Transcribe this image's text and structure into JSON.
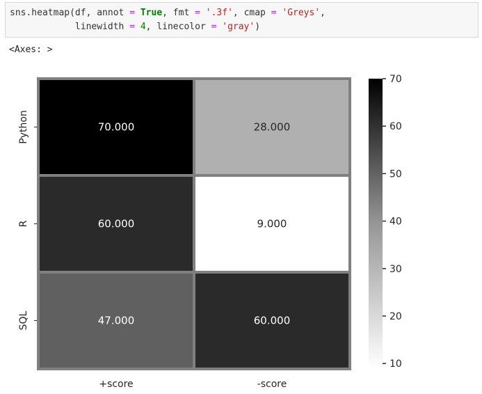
{
  "code_cell": {
    "line1": [
      {
        "t": "sns.heatmap(df, annot ",
        "c": ""
      },
      {
        "t": "=",
        "c": "tok-op"
      },
      {
        "t": " ",
        "c": ""
      },
      {
        "t": "True",
        "c": "tok-kw"
      },
      {
        "t": ", fmt ",
        "c": ""
      },
      {
        "t": "=",
        "c": "tok-op"
      },
      {
        "t": " ",
        "c": ""
      },
      {
        "t": "'.3f'",
        "c": "tok-str"
      },
      {
        "t": ", cmap ",
        "c": ""
      },
      {
        "t": "=",
        "c": "tok-op"
      },
      {
        "t": " ",
        "c": ""
      },
      {
        "t": "'Greys'",
        "c": "tok-str"
      },
      {
        "t": ",",
        "c": ""
      }
    ],
    "line2": [
      {
        "t": "            linewidth ",
        "c": ""
      },
      {
        "t": "=",
        "c": "tok-op"
      },
      {
        "t": " ",
        "c": ""
      },
      {
        "t": "4",
        "c": "tok-num"
      },
      {
        "t": ", linecolor ",
        "c": ""
      },
      {
        "t": "=",
        "c": "tok-op"
      },
      {
        "t": " ",
        "c": ""
      },
      {
        "t": "'gray'",
        "c": "tok-str"
      },
      {
        "t": ")",
        "c": ""
      }
    ]
  },
  "output_text": "<Axes: >",
  "chart_data": {
    "type": "heatmap",
    "rows": [
      "Python",
      "R",
      "SQL"
    ],
    "columns": [
      "+score",
      "-score"
    ],
    "values": [
      [
        70,
        28
      ],
      [
        60,
        9
      ],
      [
        47,
        60
      ]
    ],
    "annotations": [
      [
        "70.000",
        "28.000"
      ],
      [
        "60.000",
        "9.000"
      ],
      [
        "47.000",
        "60.000"
      ]
    ],
    "cmap": "Greys",
    "vmin": 9,
    "vmax": 70,
    "linecolor": "#808080",
    "colorbar_ticks": [
      10,
      20,
      30,
      40,
      50,
      60,
      70
    ],
    "colorbar_tick_labels": [
      "10",
      "20",
      "30",
      "40",
      "50",
      "60",
      "70"
    ]
  }
}
